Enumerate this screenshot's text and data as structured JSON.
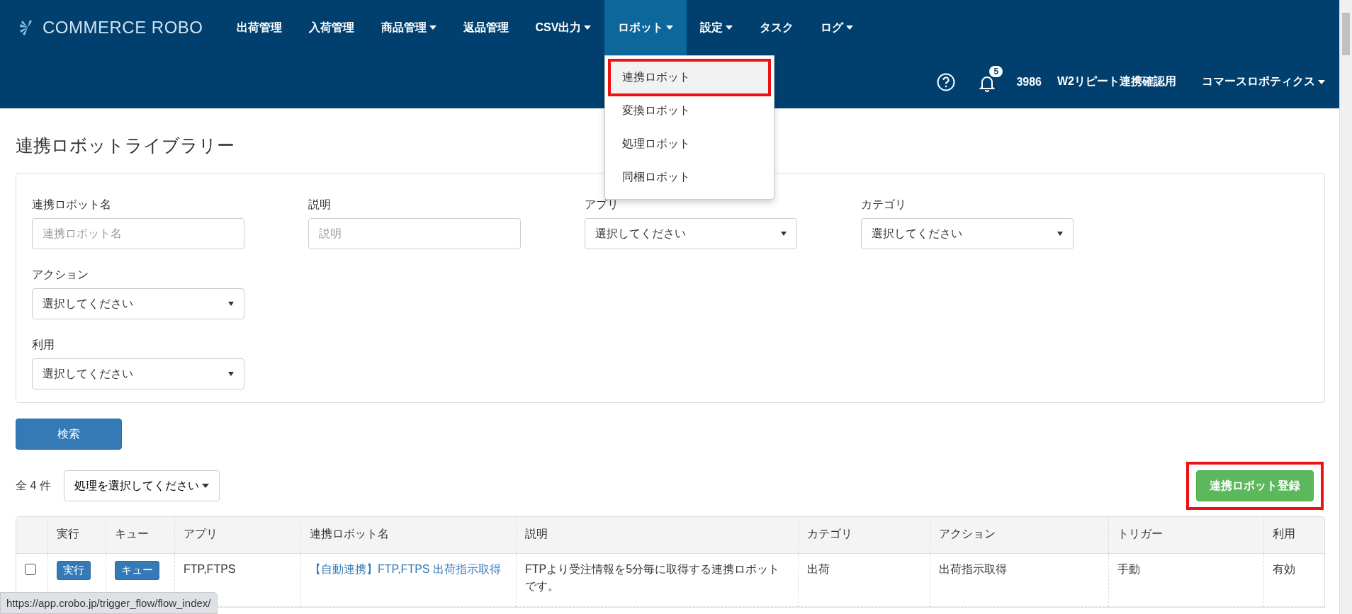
{
  "header": {
    "logo": "COMMERCE ROBO",
    "nav": [
      {
        "label": "出荷管理",
        "has_menu": false,
        "selected": false
      },
      {
        "label": "入荷管理",
        "has_menu": false,
        "selected": false
      },
      {
        "label": "商品管理",
        "has_menu": true,
        "selected": false
      },
      {
        "label": "返品管理",
        "has_menu": false,
        "selected": false
      },
      {
        "label": "CSV出力",
        "has_menu": true,
        "selected": false
      },
      {
        "label": "ロボット",
        "has_menu": true,
        "selected": true
      },
      {
        "label": "設定",
        "has_menu": true,
        "selected": false
      },
      {
        "label": "タスク",
        "has_menu": false,
        "selected": false
      },
      {
        "label": "ログ",
        "has_menu": true,
        "selected": false
      }
    ],
    "menu": [
      {
        "label": "連携ロボット",
        "selected": true,
        "highlighted": true
      },
      {
        "label": "変換ロボット",
        "selected": false,
        "highlighted": false
      },
      {
        "label": "処理ロボット",
        "selected": false,
        "highlighted": false
      },
      {
        "label": "同梱ロボット",
        "selected": false,
        "highlighted": false
      }
    ],
    "notification_count": "5",
    "account_id": "3986",
    "shop": "W2リピート連携確認用",
    "company": "コマースロボティクス"
  },
  "title": "連携ロボットライブラリー",
  "filter_rows": [
    [
      {
        "label": "連携ロボット名",
        "kind": "text",
        "placeholder": "連携ロボット名"
      },
      {
        "label": "説明",
        "kind": "text",
        "placeholder": "説明"
      },
      {
        "label": "アプリ",
        "kind": "select",
        "value": "選択してください"
      },
      {
        "label": "カテゴリ",
        "kind": "select",
        "value": "選択してください"
      }
    ],
    [
      {
        "label": "アクション",
        "kind": "select",
        "value": "選択してください"
      }
    ],
    [
      {
        "label": "利用",
        "kind": "select",
        "value": "選択してください"
      }
    ]
  ],
  "search_button": "検索",
  "result_count": "全 4 件",
  "bulk_action": "処理を選択してください",
  "register_button": {
    "label": "連携ロボット登録",
    "highlighted": true
  },
  "table": {
    "columns": [
      "実行",
      "キュー",
      "アプリ",
      "連携ロボット名",
      "説明",
      "カテゴリ",
      "アクション",
      "トリガー",
      "利用"
    ],
    "rows": [
      {
        "checked": false,
        "run": "実行",
        "queue": "キュー",
        "app": "FTP,FTPS",
        "name": "【自動連携】FTP,FTPS 出荷指示取得",
        "description": "FTPより受注情報を5分毎に取得する連携ロボットです。",
        "category": "出荷",
        "action": "出荷指示取得",
        "trigger": "手動",
        "usage": "有効"
      }
    ]
  },
  "status_url": "https://app.crobo.jp/trigger_flow/flow_index/"
}
